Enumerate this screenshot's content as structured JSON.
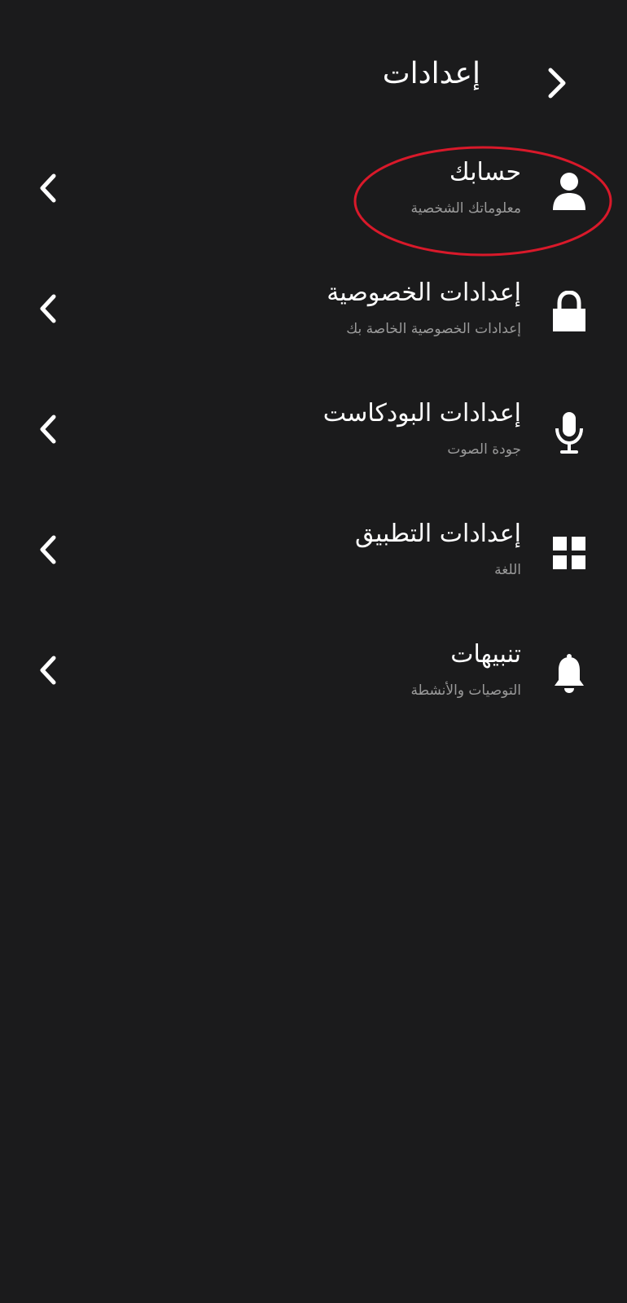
{
  "header": {
    "title": "إعدادات",
    "back_icon": "chevron-right-icon"
  },
  "settings": {
    "items": [
      {
        "title": "حسابك",
        "subtitle": "معلوماتك الشخصية",
        "icon": "person-icon"
      },
      {
        "title": "إعدادات الخصوصية",
        "subtitle": "إعدادات الخصوصية الخاصة بك",
        "icon": "lock-icon"
      },
      {
        "title": "إعدادات البودكاست",
        "subtitle": "جودة الصوت",
        "icon": "microphone-icon"
      },
      {
        "title": "إعدادات التطبيق",
        "subtitle": "اللغة",
        "icon": "grid-icon"
      },
      {
        "title": "تنبيهات",
        "subtitle": "التوصيات والأنشطة",
        "icon": "bell-icon"
      }
    ],
    "row_chevron_icon": "chevron-left-icon"
  },
  "colors": {
    "background": "#1b1b1c",
    "text": "#ffffff",
    "subtext": "#9a9a9a",
    "highlight": "#d9192a"
  }
}
